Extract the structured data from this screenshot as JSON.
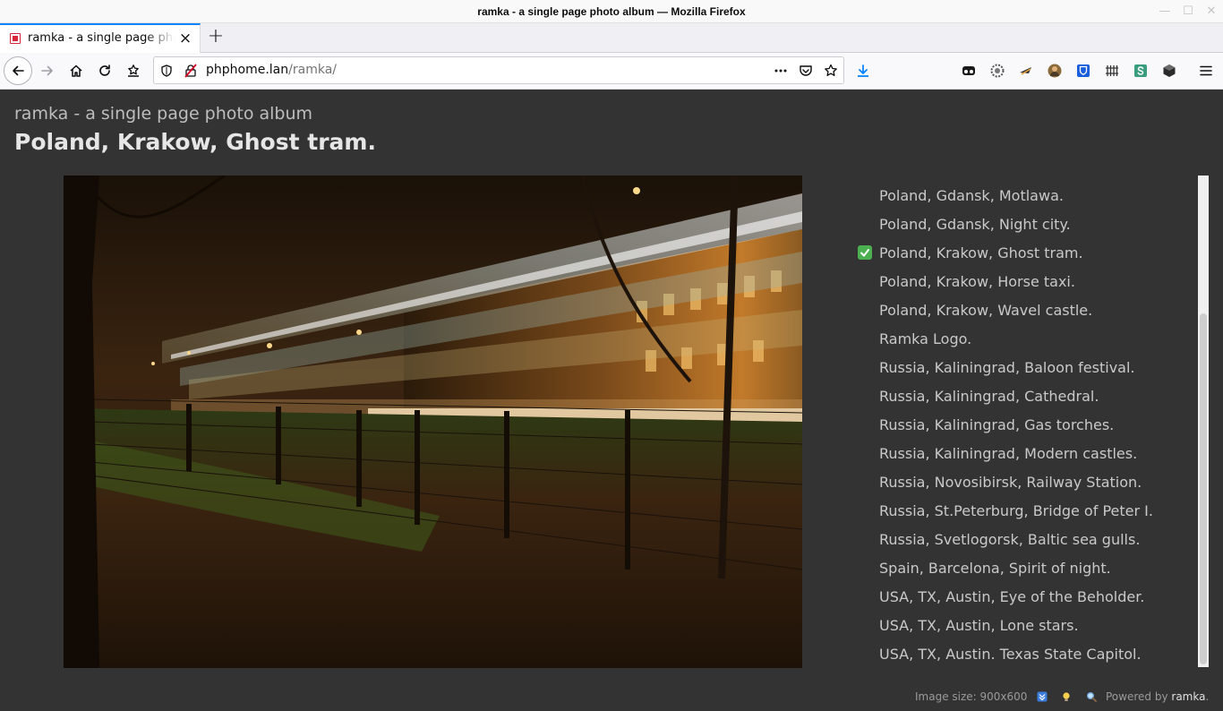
{
  "window": {
    "title": "ramka - a single page photo album — Mozilla Firefox"
  },
  "tab": {
    "label": "ramka - a single page photo album",
    "close": "×",
    "new_tab": "+"
  },
  "url": {
    "host": "phphome.lan",
    "path": "/ramka/"
  },
  "page": {
    "app_title": "ramka - a single page photo album",
    "photo_title": "Poland, Krakow, Ghost tram."
  },
  "album": {
    "selected": "Poland, Krakow, Ghost tram.",
    "items": [
      "Poland, Gdansk, Motlawa.",
      "Poland, Gdansk, Night city.",
      "Poland, Krakow, Ghost tram.",
      "Poland, Krakow, Horse taxi.",
      "Poland, Krakow, Wavel castle.",
      "Ramka Logo.",
      "Russia, Kaliningrad, Baloon festival.",
      "Russia, Kaliningrad, Cathedral.",
      "Russia, Kaliningrad, Gas torches.",
      "Russia, Kaliningrad, Modern castles.",
      "Russia, Novosibirsk, Railway Station.",
      "Russia, St.Peterburg, Bridge of Peter I.",
      "Russia, Svetlogorsk, Baltic sea gulls.",
      "Spain, Barcelona, Spirit of night.",
      "USA, TX, Austin, Eye of the Beholder.",
      "USA, TX, Austin, Lone stars.",
      "USA, TX, Austin. Texas State Capitol."
    ]
  },
  "footer": {
    "image_size": "Image size: 900x600",
    "powered_by": "Powered by",
    "brand": "ramka",
    "period": "."
  },
  "colors": {
    "page_background": "#333333",
    "selected_check": "#4caf50",
    "download_accent": "#0a84ff"
  }
}
